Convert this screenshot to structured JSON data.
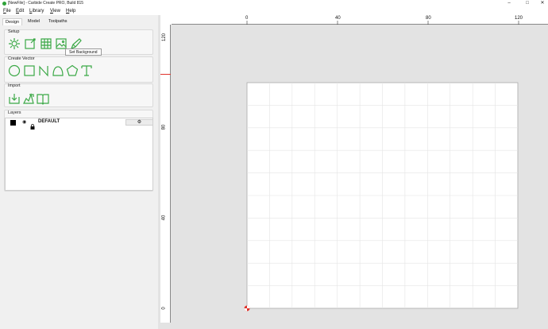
{
  "window": {
    "title": "[NewFile] - Carbide Create PRO, Build 815",
    "controls": {
      "minimize": "–",
      "maximize": "□",
      "close": "✕"
    }
  },
  "menu": [
    "File",
    "Edit",
    "Library",
    "View",
    "Help"
  ],
  "tabs": [
    "Design",
    "Model",
    "Toolpaths"
  ],
  "sections": {
    "setup": {
      "title": "Setup",
      "tools": [
        "job-setup-icon",
        "edit-icon",
        "grid-icon",
        "background-image-icon",
        "pen-icon"
      ]
    },
    "create_vector": {
      "title": "Create Vector",
      "tools": [
        "circle-icon",
        "rectangle-icon",
        "curve-icon",
        "polyline-icon",
        "polygon-icon",
        "text-icon"
      ]
    },
    "import": {
      "title": "Import",
      "tools": [
        "import-file-icon",
        "import-image-icon",
        "library-book-icon"
      ]
    },
    "layers": {
      "title": "Layers",
      "items": [
        {
          "name": "DEFAULT",
          "color": "#000000"
        }
      ]
    }
  },
  "tooltip": "Set Background",
  "rulers": {
    "horizontal": [
      "0",
      "40",
      "80",
      "120"
    ],
    "vertical": [
      "120",
      "80",
      "40",
      "0"
    ]
  },
  "colors": {
    "accent_green": "#3aa845",
    "origin_red": "#e0332b"
  }
}
